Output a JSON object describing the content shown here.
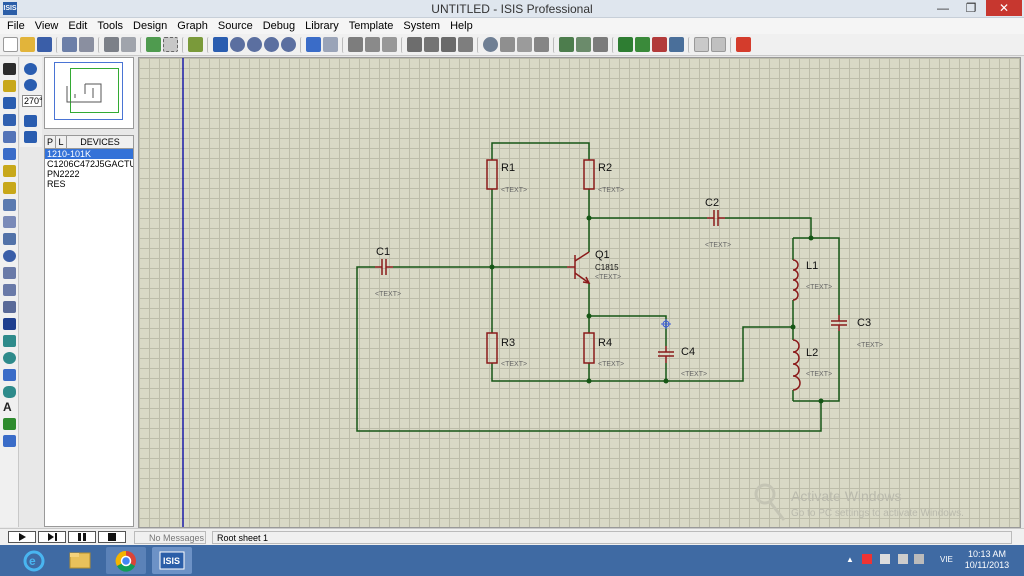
{
  "window": {
    "title": "UNTITLED - ISIS Professional",
    "logo_text": "ISIS"
  },
  "menu": [
    "File",
    "View",
    "Edit",
    "Tools",
    "Design",
    "Graph",
    "Source",
    "Debug",
    "Library",
    "Template",
    "System",
    "Help"
  ],
  "rotation": {
    "angle": "270°"
  },
  "device_picker": {
    "btn_p": "P",
    "btn_l": "L",
    "label": "DEVICES",
    "items": [
      "1210-101K",
      "C1206C472J5GACTU",
      "PN2222",
      "RES"
    ],
    "selected_index": 0
  },
  "schematic": {
    "text_placeholder": "<TEXT>",
    "components": {
      "R1": {
        "ref": "R1"
      },
      "R2": {
        "ref": "R2"
      },
      "R3": {
        "ref": "R3"
      },
      "R4": {
        "ref": "R4"
      },
      "C1": {
        "ref": "C1"
      },
      "C2": {
        "ref": "C2"
      },
      "C3": {
        "ref": "C3"
      },
      "C4": {
        "ref": "C4"
      },
      "L1": {
        "ref": "L1"
      },
      "L2": {
        "ref": "L2"
      },
      "Q1": {
        "ref": "Q1",
        "value": "C1815"
      }
    }
  },
  "watermark": {
    "title": "Activate Windows",
    "subtitle": "Go to PC settings to activate Windows."
  },
  "status": {
    "messages": "No Messages",
    "sheet": "Root sheet 1"
  },
  "taskbar": {
    "time": "10:13 AM",
    "date": "10/11/2013",
    "lang": "VIE"
  },
  "colors": {
    "wire": "#155615",
    "component": "#8b1a1a",
    "grid": "#d9d9c6",
    "taskbar": "#3f6aa3"
  }
}
